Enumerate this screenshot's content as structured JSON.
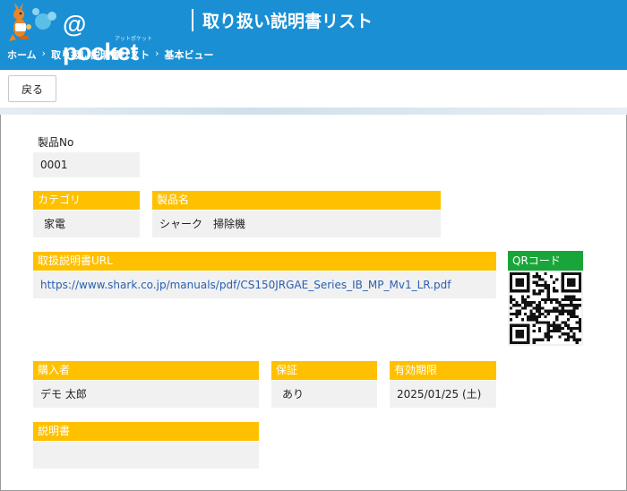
{
  "app": {
    "brand": "@ pocket",
    "brand_sub": "アットポケット",
    "title": "取り扱い説明書リスト"
  },
  "breadcrumb": {
    "items": [
      "ホーム",
      "取り扱い説明書リスト",
      "基本ビュー"
    ],
    "separator": "›"
  },
  "toolbar": {
    "back_label": "戻る"
  },
  "fields": {
    "product_no": {
      "label": "製品No",
      "value": "0001"
    },
    "category": {
      "label": "カテゴリ",
      "value": "家電"
    },
    "product_name": {
      "label": "製品名",
      "value": "シャーク　掃除機"
    },
    "manual_url": {
      "label": "取扱説明書URL",
      "value": "https://www.shark.co.jp/manuals/pdf/CS150JRGAE_Series_IB_MP_Mv1_LR.pdf"
    },
    "qr": {
      "label": "QRコード"
    },
    "purchaser": {
      "label": "購入者",
      "value": "デモ 太郎"
    },
    "warranty": {
      "label": "保証",
      "value": "あり"
    },
    "expiry": {
      "label": "有効期限",
      "value": "2025/01/25 (土)"
    },
    "description": {
      "label": "説明書",
      "value": ""
    }
  },
  "colors": {
    "header": "#1b8fd3",
    "label_bg": "#ffc000",
    "qr_label_bg": "#1aa53a",
    "value_bg": "#f1f1f1",
    "link": "#2a60b0"
  },
  "icons": {
    "logo": "kangaroo-mascot-icon",
    "qr": "qr-code-icon"
  }
}
